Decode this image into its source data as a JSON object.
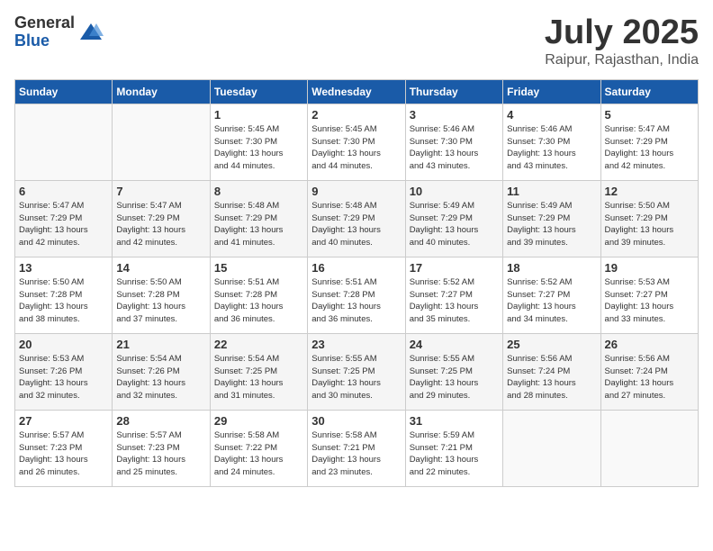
{
  "logo": {
    "general": "General",
    "blue": "Blue"
  },
  "title": "July 2025",
  "location": "Raipur, Rajasthan, India",
  "weekdays": [
    "Sunday",
    "Monday",
    "Tuesday",
    "Wednesday",
    "Thursday",
    "Friday",
    "Saturday"
  ],
  "weeks": [
    [
      {
        "day": "",
        "info": ""
      },
      {
        "day": "",
        "info": ""
      },
      {
        "day": "1",
        "info": "Sunrise: 5:45 AM\nSunset: 7:30 PM\nDaylight: 13 hours\nand 44 minutes."
      },
      {
        "day": "2",
        "info": "Sunrise: 5:45 AM\nSunset: 7:30 PM\nDaylight: 13 hours\nand 44 minutes."
      },
      {
        "day": "3",
        "info": "Sunrise: 5:46 AM\nSunset: 7:30 PM\nDaylight: 13 hours\nand 43 minutes."
      },
      {
        "day": "4",
        "info": "Sunrise: 5:46 AM\nSunset: 7:30 PM\nDaylight: 13 hours\nand 43 minutes."
      },
      {
        "day": "5",
        "info": "Sunrise: 5:47 AM\nSunset: 7:29 PM\nDaylight: 13 hours\nand 42 minutes."
      }
    ],
    [
      {
        "day": "6",
        "info": "Sunrise: 5:47 AM\nSunset: 7:29 PM\nDaylight: 13 hours\nand 42 minutes."
      },
      {
        "day": "7",
        "info": "Sunrise: 5:47 AM\nSunset: 7:29 PM\nDaylight: 13 hours\nand 42 minutes."
      },
      {
        "day": "8",
        "info": "Sunrise: 5:48 AM\nSunset: 7:29 PM\nDaylight: 13 hours\nand 41 minutes."
      },
      {
        "day": "9",
        "info": "Sunrise: 5:48 AM\nSunset: 7:29 PM\nDaylight: 13 hours\nand 40 minutes."
      },
      {
        "day": "10",
        "info": "Sunrise: 5:49 AM\nSunset: 7:29 PM\nDaylight: 13 hours\nand 40 minutes."
      },
      {
        "day": "11",
        "info": "Sunrise: 5:49 AM\nSunset: 7:29 PM\nDaylight: 13 hours\nand 39 minutes."
      },
      {
        "day": "12",
        "info": "Sunrise: 5:50 AM\nSunset: 7:29 PM\nDaylight: 13 hours\nand 39 minutes."
      }
    ],
    [
      {
        "day": "13",
        "info": "Sunrise: 5:50 AM\nSunset: 7:28 PM\nDaylight: 13 hours\nand 38 minutes."
      },
      {
        "day": "14",
        "info": "Sunrise: 5:50 AM\nSunset: 7:28 PM\nDaylight: 13 hours\nand 37 minutes."
      },
      {
        "day": "15",
        "info": "Sunrise: 5:51 AM\nSunset: 7:28 PM\nDaylight: 13 hours\nand 36 minutes."
      },
      {
        "day": "16",
        "info": "Sunrise: 5:51 AM\nSunset: 7:28 PM\nDaylight: 13 hours\nand 36 minutes."
      },
      {
        "day": "17",
        "info": "Sunrise: 5:52 AM\nSunset: 7:27 PM\nDaylight: 13 hours\nand 35 minutes."
      },
      {
        "day": "18",
        "info": "Sunrise: 5:52 AM\nSunset: 7:27 PM\nDaylight: 13 hours\nand 34 minutes."
      },
      {
        "day": "19",
        "info": "Sunrise: 5:53 AM\nSunset: 7:27 PM\nDaylight: 13 hours\nand 33 minutes."
      }
    ],
    [
      {
        "day": "20",
        "info": "Sunrise: 5:53 AM\nSunset: 7:26 PM\nDaylight: 13 hours\nand 32 minutes."
      },
      {
        "day": "21",
        "info": "Sunrise: 5:54 AM\nSunset: 7:26 PM\nDaylight: 13 hours\nand 32 minutes."
      },
      {
        "day": "22",
        "info": "Sunrise: 5:54 AM\nSunset: 7:25 PM\nDaylight: 13 hours\nand 31 minutes."
      },
      {
        "day": "23",
        "info": "Sunrise: 5:55 AM\nSunset: 7:25 PM\nDaylight: 13 hours\nand 30 minutes."
      },
      {
        "day": "24",
        "info": "Sunrise: 5:55 AM\nSunset: 7:25 PM\nDaylight: 13 hours\nand 29 minutes."
      },
      {
        "day": "25",
        "info": "Sunrise: 5:56 AM\nSunset: 7:24 PM\nDaylight: 13 hours\nand 28 minutes."
      },
      {
        "day": "26",
        "info": "Sunrise: 5:56 AM\nSunset: 7:24 PM\nDaylight: 13 hours\nand 27 minutes."
      }
    ],
    [
      {
        "day": "27",
        "info": "Sunrise: 5:57 AM\nSunset: 7:23 PM\nDaylight: 13 hours\nand 26 minutes."
      },
      {
        "day": "28",
        "info": "Sunrise: 5:57 AM\nSunset: 7:23 PM\nDaylight: 13 hours\nand 25 minutes."
      },
      {
        "day": "29",
        "info": "Sunrise: 5:58 AM\nSunset: 7:22 PM\nDaylight: 13 hours\nand 24 minutes."
      },
      {
        "day": "30",
        "info": "Sunrise: 5:58 AM\nSunset: 7:21 PM\nDaylight: 13 hours\nand 23 minutes."
      },
      {
        "day": "31",
        "info": "Sunrise: 5:59 AM\nSunset: 7:21 PM\nDaylight: 13 hours\nand 22 minutes."
      },
      {
        "day": "",
        "info": ""
      },
      {
        "day": "",
        "info": ""
      }
    ]
  ]
}
